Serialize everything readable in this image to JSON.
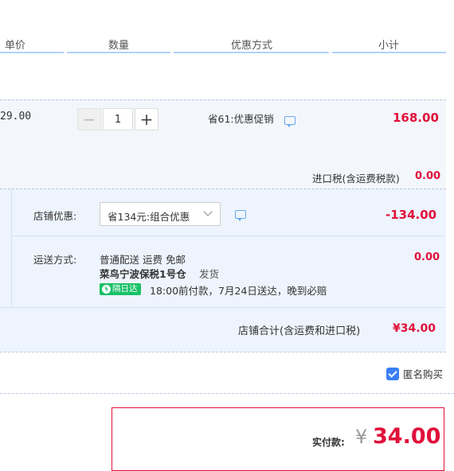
{
  "columns": {
    "unit_price": "单价",
    "quantity": "数量",
    "discount": "优惠方式",
    "subtotal": "小计"
  },
  "item": {
    "unit_price": "29.00",
    "quantity": "1",
    "promotion": "省61:优惠促销",
    "subtotal": "168.00",
    "import_tax_label": "进口税(含运费税款)",
    "import_tax_value": "0.00"
  },
  "shop": {
    "discount_label": "店铺优惠:",
    "discount_selected": "省134元:组合优惠",
    "discount_value": "-134.00",
    "shipping_label": "运送方式:",
    "shipping_method": "普通配送 运费 免邮",
    "warehouse": "菜鸟宁波保税1号仓",
    "dispatch": "发货",
    "badge": "隔日达",
    "delivery_note": "18:00前付款，7月24日送达，晚到必赔",
    "shipping_value": "0.00",
    "total_label": "店铺合计(含运费和进口税)",
    "total_value": "¥34.00"
  },
  "anonymous": {
    "label": "匿名购买",
    "checked": true
  },
  "payment": {
    "label": "实付款:",
    "currency": "¥",
    "amount": "34.00"
  },
  "colors": {
    "accent_red": "#e0103a",
    "header_line": "#b2d1ff",
    "panel_bg": "#eef4fd",
    "badge_green": "#18c167",
    "checkbox_blue": "#3a7ff6"
  },
  "icons": [
    "minus-icon",
    "plus-icon",
    "chat-bubble-icon",
    "chevron-down-icon",
    "checkbox-icon",
    "lightning-icon"
  ]
}
